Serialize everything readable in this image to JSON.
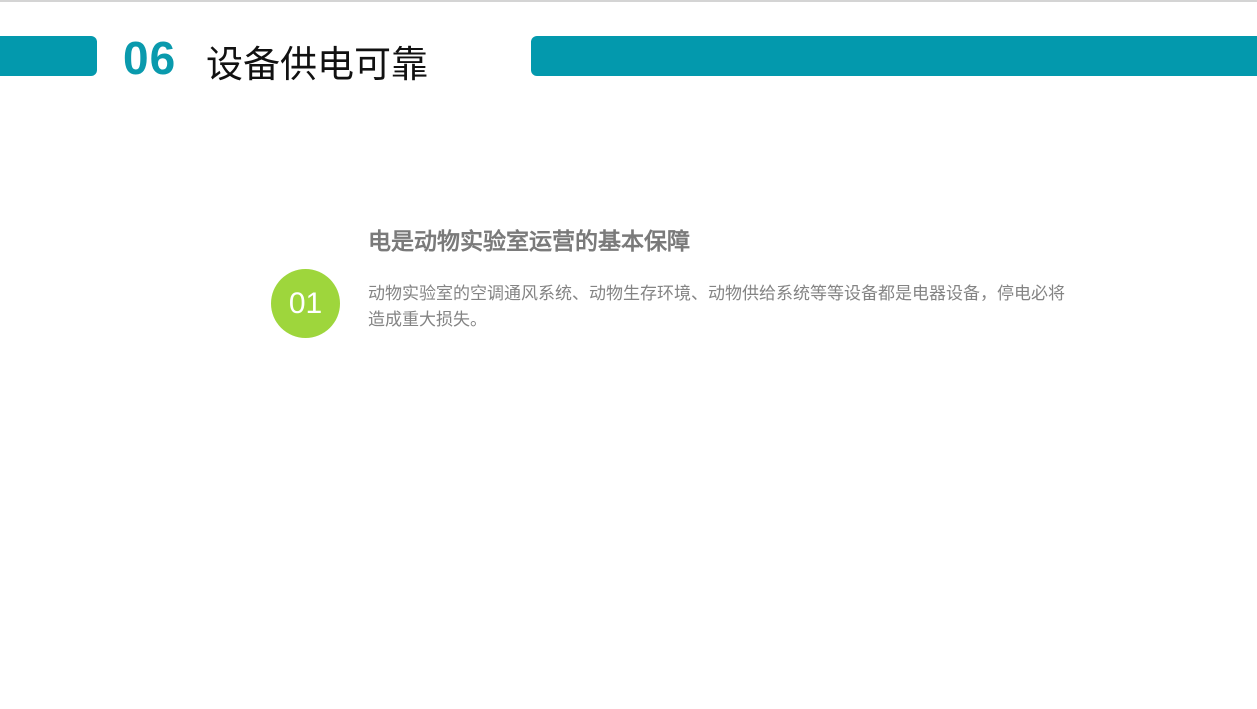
{
  "header": {
    "number": "06",
    "title": "设备供电可靠"
  },
  "items": [
    {
      "index": "01",
      "heading": "电是动物实验室运营的基本保障",
      "text": "动物实验室的空调通风系统、动物生存环境、动物供给系统等等设备都是电器设备，停电必将造成重大损失。"
    }
  ],
  "colors": {
    "accent_teal": "#0399ad",
    "circle_green": "#9ed63c",
    "heading_gray": "#7a7a7a",
    "body_gray": "#848484"
  }
}
